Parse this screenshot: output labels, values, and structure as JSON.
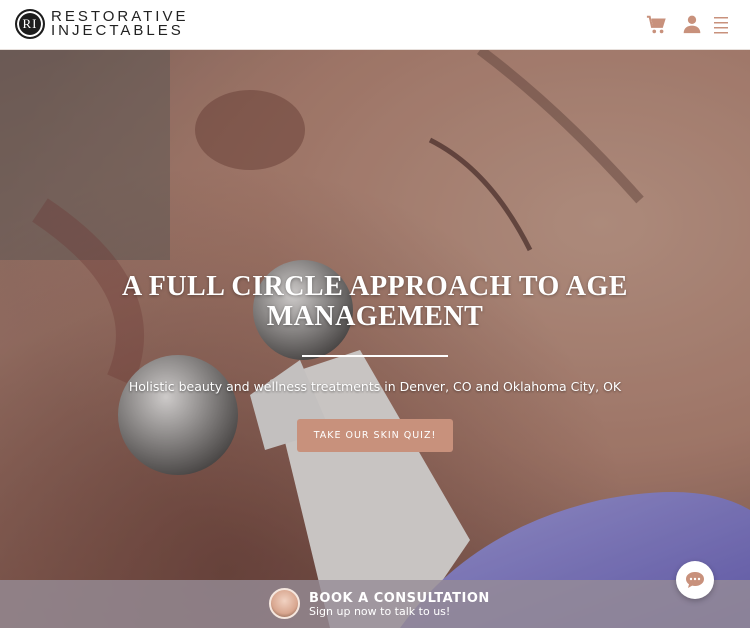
{
  "brand": {
    "mark": "RI",
    "line1": "RESTORATIVE",
    "line2": "INJECTABLES"
  },
  "header": {
    "icons": [
      "cart-icon",
      "user-icon",
      "menu-icon"
    ],
    "accent": "#c8917c"
  },
  "hero": {
    "title": "A FULL CIRCLE APPROACH TO AGE MANAGEMENT",
    "subtitle": "Holistic beauty and wellness treatments in Denver, CO and Oklahoma City, OK",
    "cta_label": "TAKE OUR SKIN QUIZ!"
  },
  "consult": {
    "title": "BOOK A CONSULTATION",
    "subtitle": "Sign up now to talk to us!"
  },
  "chat": {
    "icon": "chat-bubble-icon"
  }
}
